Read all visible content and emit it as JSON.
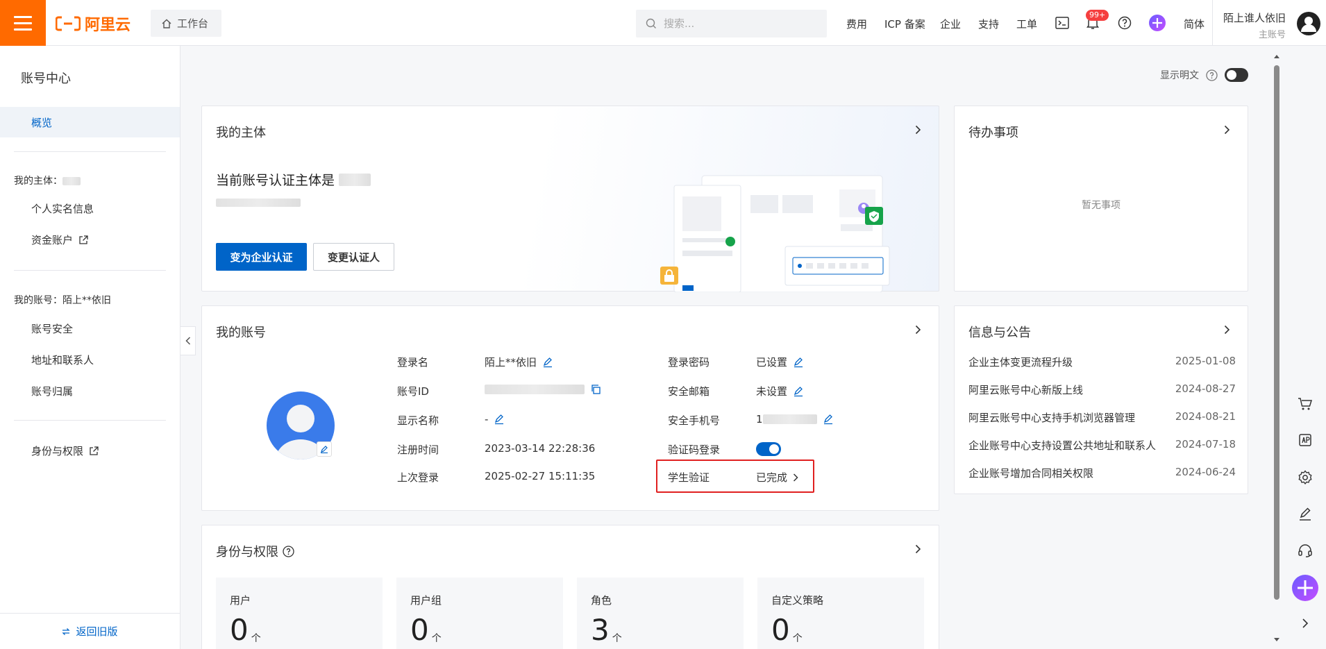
{
  "topbar": {
    "logo_text": "阿里云",
    "workbench_label": "工作台",
    "search_placeholder": "搜索...",
    "nav": [
      "费用",
      "ICP 备案",
      "企业",
      "支持",
      "工单"
    ],
    "notification_count": "99+",
    "language": "简体",
    "user_name": "陌上谁人依旧",
    "user_role": "主账号"
  },
  "sidebar": {
    "title": "账号中心",
    "active_item": "概览",
    "group_entity": "我的主体：",
    "entity_items": [
      "个人实名信息",
      "资金账户"
    ],
    "group_account": "我的账号：陌上**依旧",
    "account_items": [
      "账号安全",
      "地址和联系人",
      "账号归属"
    ],
    "identity_item": "身份与权限",
    "footer": "返回旧版"
  },
  "plaintext_toggle": {
    "label": "显示明文"
  },
  "entity_card": {
    "title": "我的主体",
    "heading": "当前账号认证主体是",
    "primary_button": "变为企业认证",
    "secondary_button": "变更认证人"
  },
  "todo_card": {
    "title": "待办事项",
    "empty": "暂无事项"
  },
  "account_card": {
    "title": "我的账号",
    "left": [
      {
        "label": "登录名",
        "value": "陌上**依旧"
      },
      {
        "label": "账号ID",
        "value": ""
      },
      {
        "label": "显示名称",
        "value": "-"
      },
      {
        "label": "注册时间",
        "value": "2023-03-14 22:28:36"
      },
      {
        "label": "上次登录",
        "value": "2025-02-27 15:11:35"
      }
    ],
    "right": [
      {
        "label": "登录密码",
        "value": "已设置"
      },
      {
        "label": "安全邮箱",
        "value": "未设置"
      },
      {
        "label": "安全手机号",
        "value": "1"
      },
      {
        "label": "验证码登录",
        "value": ""
      },
      {
        "label": "学生验证",
        "value": "已完成"
      }
    ],
    "captcha_login_enabled": true
  },
  "news_card": {
    "title": "信息与公告",
    "items": [
      {
        "title": "企业主体变更流程升级",
        "date": "2025-01-08"
      },
      {
        "title": "阿里云账号中心新版上线",
        "date": "2024-08-27"
      },
      {
        "title": "阿里云账号中心支持手机浏览器管理",
        "date": "2024-08-21"
      },
      {
        "title": "企业账号中心支持设置公共地址和联系人",
        "date": "2024-07-18"
      },
      {
        "title": "企业账号增加合同相关权限",
        "date": "2024-06-24"
      }
    ]
  },
  "identity_card": {
    "title": "身份与权限",
    "stats": [
      {
        "label": "用户",
        "value": "0",
        "unit": "个"
      },
      {
        "label": "用户组",
        "value": "0",
        "unit": "个"
      },
      {
        "label": "角色",
        "value": "3",
        "unit": "个"
      },
      {
        "label": "自定义策略",
        "value": "0",
        "unit": "个"
      }
    ]
  },
  "colors": {
    "brand": "#ff6a00",
    "primary": "#0064c8",
    "highlight": "#e02020"
  }
}
